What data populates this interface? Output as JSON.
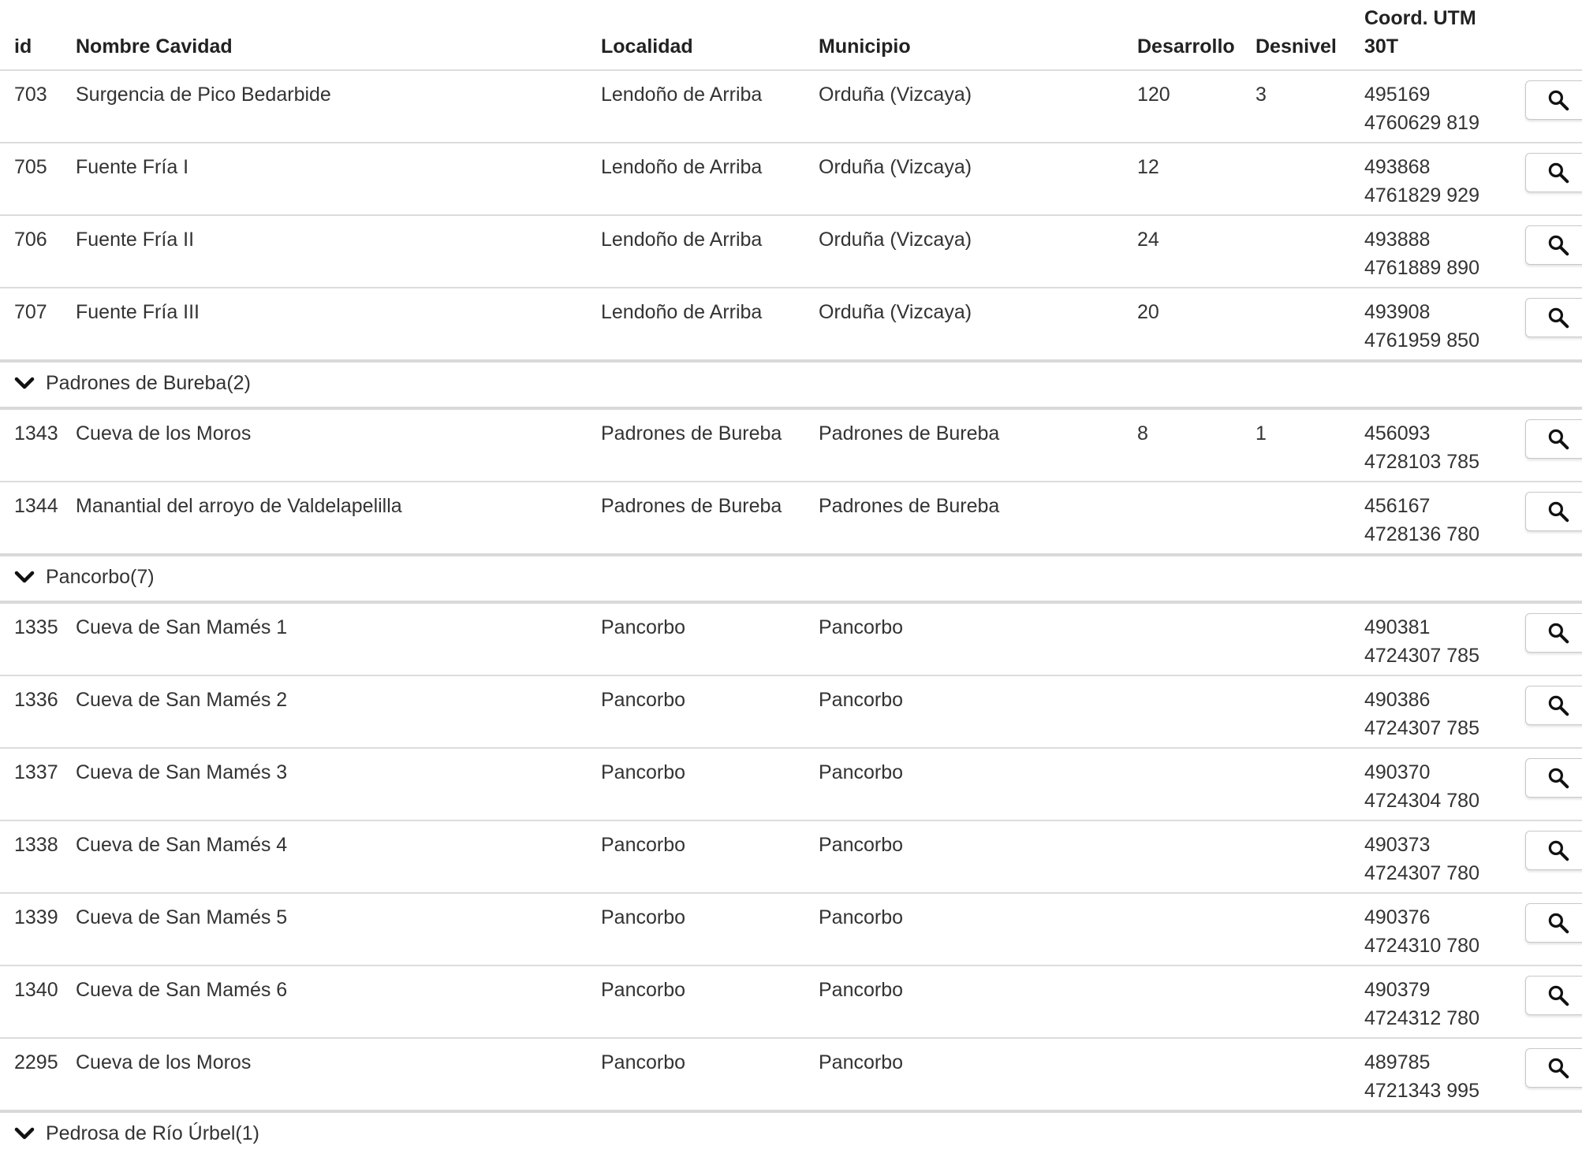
{
  "columns": {
    "id": "id",
    "nombre": "Nombre Cavidad",
    "localidad": "Localidad",
    "municipio": "Municipio",
    "desarrollo": "Desarrollo",
    "desnivel": "Desnivel",
    "coord_line1": "Coord. UTM",
    "coord_line2": "30T"
  },
  "icons": {
    "row_action": "search-icon",
    "group_toggle": "chevron-down-icon"
  },
  "sections": [
    {
      "group": null,
      "rows": [
        {
          "id": "703",
          "nombre": "Surgencia de Pico Bedarbide",
          "localidad": "Lendoño de Arriba",
          "municipio": "Orduña (Vizcaya)",
          "desarrollo": "120",
          "desnivel": "3",
          "coord1": "495169",
          "coord2": "4760629 819"
        },
        {
          "id": "705",
          "nombre": "Fuente Fría I",
          "localidad": "Lendoño de Arriba",
          "municipio": "Orduña (Vizcaya)",
          "desarrollo": "12",
          "desnivel": "",
          "coord1": "493868",
          "coord2": "4761829 929"
        },
        {
          "id": "706",
          "nombre": "Fuente Fría II",
          "localidad": "Lendoño de Arriba",
          "municipio": "Orduña (Vizcaya)",
          "desarrollo": "24",
          "desnivel": "",
          "coord1": "493888",
          "coord2": "4761889 890"
        },
        {
          "id": "707",
          "nombre": "Fuente Fría III",
          "localidad": "Lendoño de Arriba",
          "municipio": "Orduña (Vizcaya)",
          "desarrollo": "20",
          "desnivel": "",
          "coord1": "493908",
          "coord2": "4761959 850"
        }
      ]
    },
    {
      "group": "Padrones de Bureba(2)",
      "rows": [
        {
          "id": "1343",
          "nombre": "Cueva de los Moros",
          "localidad": "Padrones de Bureba",
          "municipio": "Padrones de Bureba",
          "desarrollo": "8",
          "desnivel": "1",
          "coord1": "456093",
          "coord2": "4728103 785"
        },
        {
          "id": "1344",
          "nombre": "Manantial del arroyo de Valdelapelilla",
          "localidad": "Padrones de Bureba",
          "municipio": "Padrones de Bureba",
          "desarrollo": "",
          "desnivel": "",
          "coord1": "456167",
          "coord2": "4728136 780"
        }
      ]
    },
    {
      "group": "Pancorbo(7)",
      "rows": [
        {
          "id": "1335",
          "nombre": "Cueva de San Mamés 1",
          "localidad": "Pancorbo",
          "municipio": "Pancorbo",
          "desarrollo": "",
          "desnivel": "",
          "coord1": "490381",
          "coord2": "4724307 785"
        },
        {
          "id": "1336",
          "nombre": "Cueva de San Mamés 2",
          "localidad": "Pancorbo",
          "municipio": "Pancorbo",
          "desarrollo": "",
          "desnivel": "",
          "coord1": "490386",
          "coord2": "4724307 785"
        },
        {
          "id": "1337",
          "nombre": "Cueva de San Mamés 3",
          "localidad": "Pancorbo",
          "municipio": "Pancorbo",
          "desarrollo": "",
          "desnivel": "",
          "coord1": "490370",
          "coord2": "4724304 780"
        },
        {
          "id": "1338",
          "nombre": "Cueva de San Mamés 4",
          "localidad": "Pancorbo",
          "municipio": "Pancorbo",
          "desarrollo": "",
          "desnivel": "",
          "coord1": "490373",
          "coord2": "4724307 780"
        },
        {
          "id": "1339",
          "nombre": "Cueva de San Mamés 5",
          "localidad": "Pancorbo",
          "municipio": "Pancorbo",
          "desarrollo": "",
          "desnivel": "",
          "coord1": "490376",
          "coord2": "4724310 780"
        },
        {
          "id": "1340",
          "nombre": "Cueva de San Mamés 6",
          "localidad": "Pancorbo",
          "municipio": "Pancorbo",
          "desarrollo": "",
          "desnivel": "",
          "coord1": "490379",
          "coord2": "4724312 780"
        },
        {
          "id": "2295",
          "nombre": "Cueva de los Moros",
          "localidad": "Pancorbo",
          "municipio": "Pancorbo",
          "desarrollo": "",
          "desnivel": "",
          "coord1": "489785",
          "coord2": "4721343 995"
        }
      ]
    },
    {
      "group": "Pedrosa de Río Úrbel(1)",
      "rows": []
    }
  ]
}
